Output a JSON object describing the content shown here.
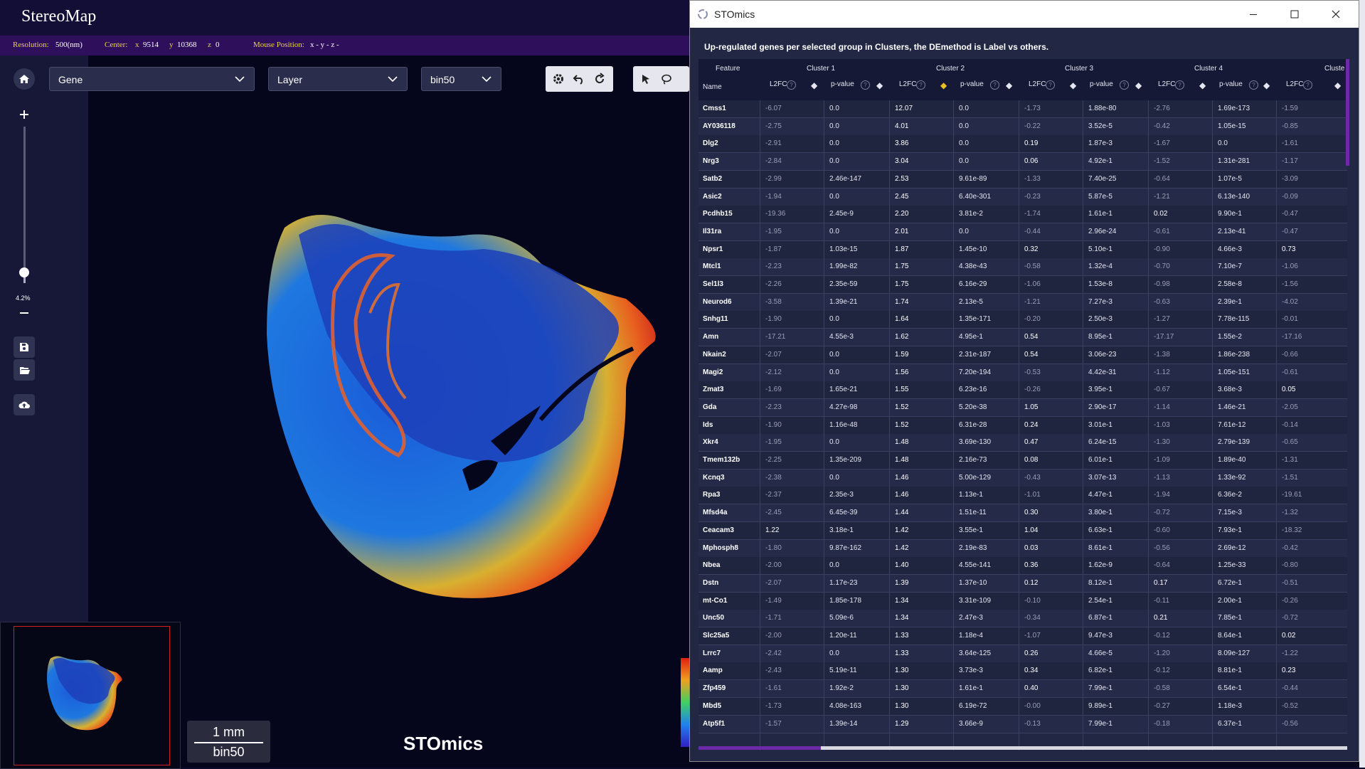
{
  "app": {
    "title": "StereoMap"
  },
  "status": {
    "resolution_label": "Resolution:",
    "resolution_value": "500(nm)",
    "center_label": "Center:",
    "cx_label": "x",
    "cx": "9514",
    "cy_label": "y",
    "cy": "10368",
    "cz_label": "z",
    "cz": "0",
    "mouse_label": "Mouse Position:",
    "mouse_value": "x - y - z -"
  },
  "toolbar": {
    "gene": "Gene",
    "layer": "Layer",
    "bin": "bin50"
  },
  "zoom": {
    "label": "4.2%",
    "level": 0.07
  },
  "scalebar": {
    "length": "1 mm",
    "bin": "bin50"
  },
  "watermark": "STOmics",
  "window": {
    "title": "STOmics",
    "heading": "Up-regulated genes per selected group in Clusters, the DEmethod is Label vs others.",
    "feature_header": "Feature",
    "name_header": "Name",
    "clusters": [
      "Cluster 1",
      "Cluster 2",
      "Cluster 3",
      "Cluster 4",
      "Cluste"
    ],
    "sub_headers": [
      "L2FC",
      "p-value"
    ],
    "rows": [
      {
        "name": "Cmss1",
        "c": [
          "-6.07",
          "0.0",
          "12.07",
          "0.0",
          "-1.73",
          "1.88e-80",
          "-2.76",
          "1.69e-173",
          "-1.59"
        ]
      },
      {
        "name": "AY036118",
        "c": [
          "-2.75",
          "0.0",
          "4.01",
          "0.0",
          "-0.22",
          "3.52e-5",
          "-0.42",
          "1.05e-15",
          "-0.85"
        ]
      },
      {
        "name": "Dlg2",
        "c": [
          "-2.91",
          "0.0",
          "3.86",
          "0.0",
          "0.19",
          "1.87e-3",
          "-1.67",
          "0.0",
          "-1.61"
        ]
      },
      {
        "name": "Nrg3",
        "c": [
          "-2.84",
          "0.0",
          "3.04",
          "0.0",
          "0.06",
          "4.92e-1",
          "-1.52",
          "1.31e-281",
          "-1.17"
        ]
      },
      {
        "name": "Satb2",
        "c": [
          "-2.99",
          "2.46e-147",
          "2.53",
          "9.61e-89",
          "-1.33",
          "7.40e-25",
          "-0.64",
          "1.07e-5",
          "-3.09"
        ]
      },
      {
        "name": "Asic2",
        "c": [
          "-1.94",
          "0.0",
          "2.45",
          "6.40e-301",
          "-0.23",
          "5.87e-5",
          "-1.21",
          "6.13e-140",
          "-0.09"
        ]
      },
      {
        "name": "Pcdhb15",
        "c": [
          "-19.36",
          "2.45e-9",
          "2.20",
          "3.81e-2",
          "-1.74",
          "1.61e-1",
          "0.02",
          "9.90e-1",
          "-0.47"
        ]
      },
      {
        "name": "Il31ra",
        "c": [
          "-1.95",
          "0.0",
          "2.01",
          "0.0",
          "-0.44",
          "2.96e-24",
          "-0.61",
          "2.13e-41",
          "-0.47"
        ]
      },
      {
        "name": "Npsr1",
        "c": [
          "-1.87",
          "1.03e-15",
          "1.87",
          "1.45e-10",
          "0.32",
          "5.10e-1",
          "-0.90",
          "4.66e-3",
          "0.73"
        ]
      },
      {
        "name": "Mtcl1",
        "c": [
          "-2.23",
          "1.99e-82",
          "1.75",
          "4.38e-43",
          "-0.58",
          "1.32e-4",
          "-0.70",
          "7.10e-7",
          "-1.06"
        ]
      },
      {
        "name": "Sel1l3",
        "c": [
          "-2.26",
          "2.35e-59",
          "1.75",
          "6.16e-29",
          "-1.06",
          "1.53e-8",
          "-0.98",
          "2.58e-8",
          "-1.56"
        ]
      },
      {
        "name": "Neurod6",
        "c": [
          "-3.58",
          "1.39e-21",
          "1.74",
          "2.13e-5",
          "-1.21",
          "7.27e-3",
          "-0.63",
          "2.39e-1",
          "-4.02"
        ]
      },
      {
        "name": "Snhg11",
        "c": [
          "-1.90",
          "0.0",
          "1.64",
          "1.35e-171",
          "-0.20",
          "2.50e-3",
          "-1.27",
          "7.78e-115",
          "-0.01"
        ]
      },
      {
        "name": "Amn",
        "c": [
          "-17.21",
          "4.55e-3",
          "1.62",
          "4.95e-1",
          "0.54",
          "8.95e-1",
          "-17.17",
          "1.55e-2",
          "-17.16"
        ]
      },
      {
        "name": "Nkain2",
        "c": [
          "-2.07",
          "0.0",
          "1.59",
          "2.31e-187",
          "0.54",
          "3.06e-23",
          "-1.38",
          "1.86e-238",
          "-0.66"
        ]
      },
      {
        "name": "Magi2",
        "c": [
          "-2.12",
          "0.0",
          "1.56",
          "7.20e-194",
          "-0.53",
          "4.42e-31",
          "-1.12",
          "1.05e-151",
          "-0.61"
        ]
      },
      {
        "name": "Zmat3",
        "c": [
          "-1.69",
          "1.65e-21",
          "1.55",
          "6.23e-16",
          "-0.26",
          "3.95e-1",
          "-0.67",
          "3.68e-3",
          "0.05"
        ]
      },
      {
        "name": "Gda",
        "c": [
          "-2.23",
          "4.27e-98",
          "1.52",
          "5.20e-38",
          "1.05",
          "2.90e-17",
          "-1.14",
          "1.46e-21",
          "-2.05"
        ]
      },
      {
        "name": "Ids",
        "c": [
          "-1.90",
          "1.16e-48",
          "1.52",
          "6.31e-28",
          "0.24",
          "3.01e-1",
          "-1.03",
          "7.61e-12",
          "-0.14"
        ]
      },
      {
        "name": "Xkr4",
        "c": [
          "-1.95",
          "0.0",
          "1.48",
          "3.69e-130",
          "0.47",
          "6.24e-15",
          "-1.30",
          "2.79e-139",
          "-0.65"
        ]
      },
      {
        "name": "Tmem132b",
        "c": [
          "-2.25",
          "1.35e-209",
          "1.48",
          "2.16e-73",
          "0.08",
          "6.01e-1",
          "-1.09",
          "1.89e-40",
          "-1.31"
        ]
      },
      {
        "name": "Kcnq3",
        "c": [
          "-2.38",
          "0.0",
          "1.46",
          "5.00e-129",
          "-0.43",
          "3.07e-13",
          "-1.13",
          "1.33e-92",
          "-1.51"
        ]
      },
      {
        "name": "Rpa3",
        "c": [
          "-2.37",
          "2.35e-3",
          "1.46",
          "1.13e-1",
          "-1.01",
          "4.47e-1",
          "-1.94",
          "6.36e-2",
          "-19.61"
        ]
      },
      {
        "name": "Mfsd4a",
        "c": [
          "-2.45",
          "6.45e-39",
          "1.44",
          "1.51e-11",
          "0.30",
          "3.80e-1",
          "-0.72",
          "7.15e-3",
          "-1.32"
        ]
      },
      {
        "name": "Ceacam3",
        "c": [
          "1.22",
          "3.18e-1",
          "1.42",
          "3.55e-1",
          "1.04",
          "6.63e-1",
          "-0.60",
          "7.93e-1",
          "-18.32"
        ]
      },
      {
        "name": "Mphosph8",
        "c": [
          "-1.80",
          "9.87e-162",
          "1.42",
          "2.19e-83",
          "0.03",
          "8.61e-1",
          "-0.56",
          "2.69e-12",
          "-0.42"
        ]
      },
      {
        "name": "Nbea",
        "c": [
          "-2.00",
          "0.0",
          "1.40",
          "4.55e-141",
          "0.36",
          "1.62e-9",
          "-0.64",
          "1.25e-33",
          "-0.80"
        ]
      },
      {
        "name": "Dstn",
        "c": [
          "-2.07",
          "1.17e-23",
          "1.39",
          "1.37e-10",
          "0.12",
          "8.12e-1",
          "0.17",
          "6.72e-1",
          "-0.51"
        ]
      },
      {
        "name": "mt-Co1",
        "c": [
          "-1.49",
          "1.85e-178",
          "1.34",
          "3.31e-109",
          "-0.10",
          "2.54e-1",
          "-0.11",
          "2.00e-1",
          "-0.26"
        ]
      },
      {
        "name": "Unc50",
        "c": [
          "-1.71",
          "5.09e-6",
          "1.34",
          "2.47e-3",
          "-0.34",
          "6.87e-1",
          "0.21",
          "7.85e-1",
          "-0.72"
        ]
      },
      {
        "name": "Slc25a5",
        "c": [
          "-2.00",
          "1.20e-11",
          "1.33",
          "1.18e-4",
          "-1.07",
          "9.47e-3",
          "-0.12",
          "8.64e-1",
          "0.02"
        ]
      },
      {
        "name": "Lrrc7",
        "c": [
          "-2.42",
          "0.0",
          "1.33",
          "3.64e-125",
          "0.26",
          "4.66e-5",
          "-1.20",
          "8.09e-127",
          "-1.22"
        ]
      },
      {
        "name": "Aamp",
        "c": [
          "-2.43",
          "5.19e-11",
          "1.30",
          "3.73e-3",
          "0.34",
          "6.82e-1",
          "-0.12",
          "8.81e-1",
          "0.23"
        ]
      },
      {
        "name": "Zfp459",
        "c": [
          "-1.61",
          "1.92e-2",
          "1.30",
          "1.61e-1",
          "0.40",
          "7.99e-1",
          "-0.58",
          "6.54e-1",
          "-0.44"
        ]
      },
      {
        "name": "Mbd5",
        "c": [
          "-1.73",
          "4.08e-163",
          "1.30",
          "6.19e-72",
          "-0.00",
          "9.89e-1",
          "-0.27",
          "1.18e-3",
          "-0.52"
        ]
      },
      {
        "name": "Atp5f1",
        "c": [
          "-1.57",
          "1.39e-14",
          "1.29",
          "3.66e-9",
          "-0.13",
          "7.99e-1",
          "-0.18",
          "6.37e-1",
          "-0.56"
        ]
      }
    ]
  },
  "colors": {
    "status_label": "#e8d24a",
    "purple": "#2e0f5c",
    "accent": "#6c2aa8",
    "sort_active": "#e8c020"
  }
}
